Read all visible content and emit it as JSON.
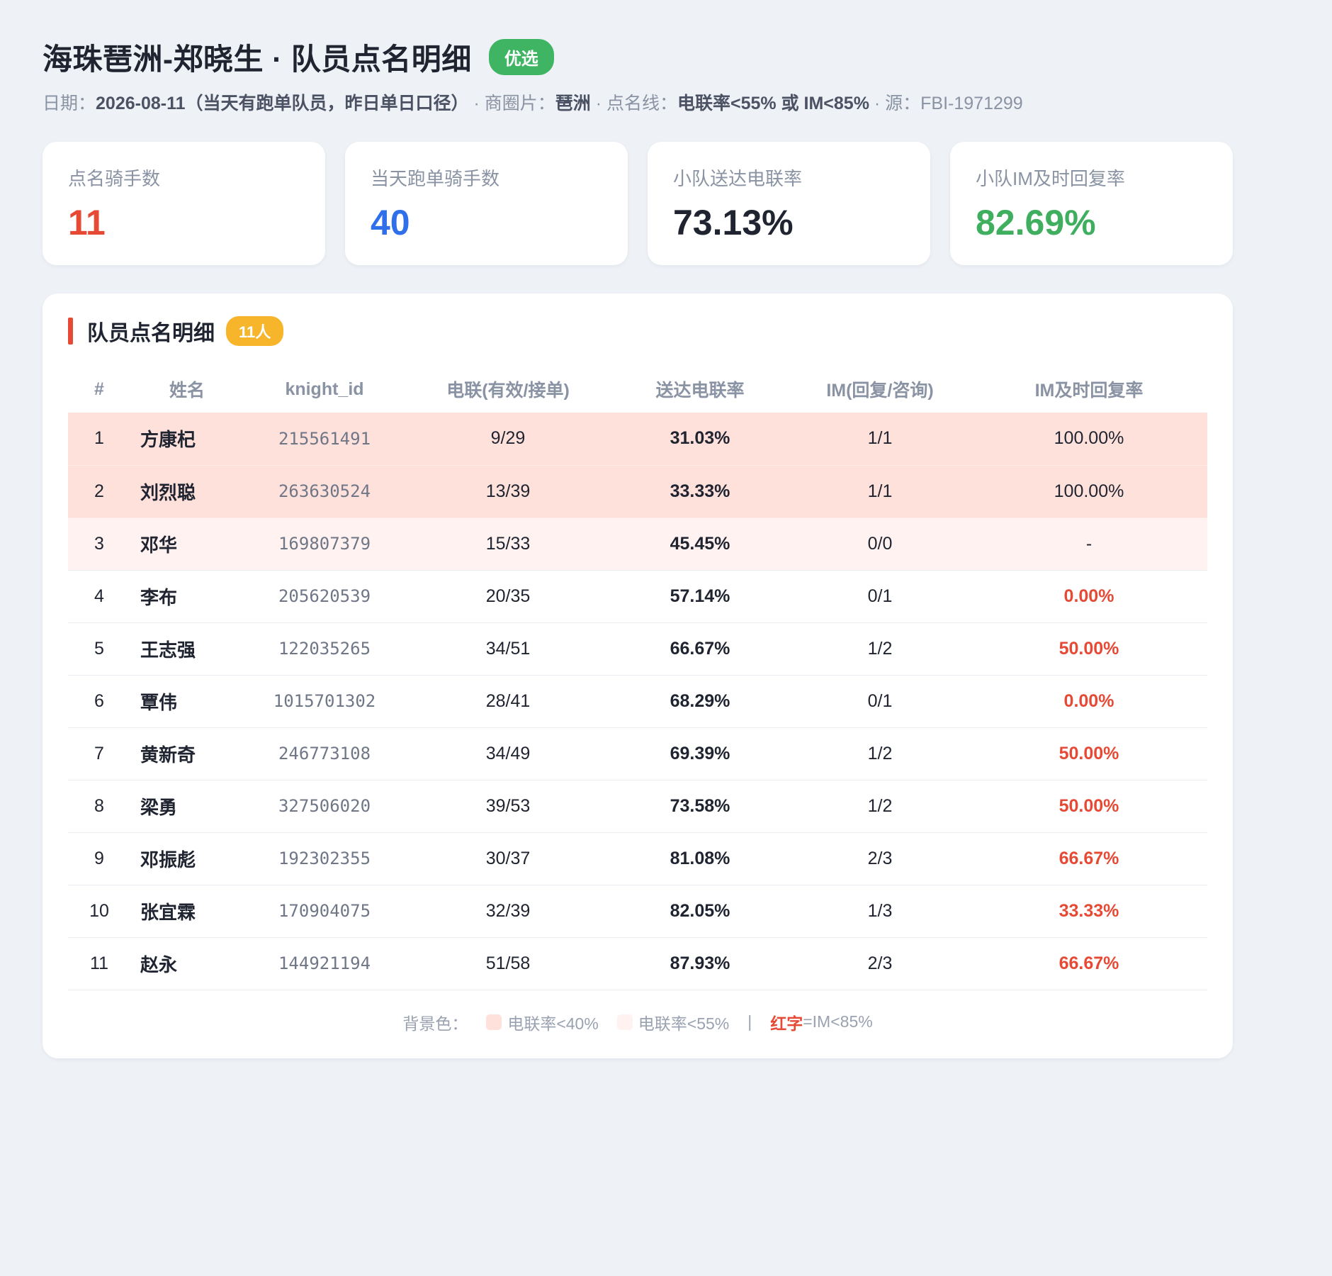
{
  "header": {
    "title": "海珠琶洲-郑晓生 · 队员点名明细",
    "badge": "优选",
    "date_label": "日期：",
    "date_value": "2026-08-11（当天有跑单队员，昨日单日口径）",
    "area_label": " · 商圈片：",
    "area_value": "琶洲",
    "line_label": " · 点名线：",
    "line_value": "电联率<55% 或 IM<85%",
    "source_text": " · 源：FBI-1971299"
  },
  "cards": [
    {
      "label": "点名骑手数",
      "value": "11",
      "color": "#e64a35"
    },
    {
      "label": "当天跑单骑手数",
      "value": "40",
      "color": "#2f6fea"
    },
    {
      "label": "小队送达电联率",
      "value": "73.13%",
      "color": "#1f2430"
    },
    {
      "label": "小队IM及时回复率",
      "value": "82.69%",
      "color": "#3fae5f"
    }
  ],
  "panel": {
    "title": "队员点名明细",
    "count": "11人"
  },
  "table": {
    "headers": [
      "#",
      "姓名",
      "knight_id",
      "电联(有效/接单)",
      "送达电联率",
      "IM(回复/咨询)",
      "IM及时回复率"
    ],
    "rows": [
      {
        "idx": "1",
        "name": "方康杞",
        "kid": "215561491",
        "call": "9/29",
        "rate": "31.03%",
        "im": "1/1",
        "im_rate": "100.00%",
        "bg": "strong",
        "im_bad": false
      },
      {
        "idx": "2",
        "name": "刘烈聪",
        "kid": "263630524",
        "call": "13/39",
        "rate": "33.33%",
        "im": "1/1",
        "im_rate": "100.00%",
        "bg": "strong",
        "im_bad": false
      },
      {
        "idx": "3",
        "name": "邓华",
        "kid": "169807379",
        "call": "15/33",
        "rate": "45.45%",
        "im": "0/0",
        "im_rate": "-",
        "bg": "light",
        "im_bad": false
      },
      {
        "idx": "4",
        "name": "李布",
        "kid": "205620539",
        "call": "20/35",
        "rate": "57.14%",
        "im": "0/1",
        "im_rate": "0.00%",
        "bg": "none",
        "im_bad": true
      },
      {
        "idx": "5",
        "name": "王志强",
        "kid": "122035265",
        "call": "34/51",
        "rate": "66.67%",
        "im": "1/2",
        "im_rate": "50.00%",
        "bg": "none",
        "im_bad": true
      },
      {
        "idx": "6",
        "name": "覃伟",
        "kid": "1015701302",
        "call": "28/41",
        "rate": "68.29%",
        "im": "0/1",
        "im_rate": "0.00%",
        "bg": "none",
        "im_bad": true
      },
      {
        "idx": "7",
        "name": "黄新奇",
        "kid": "246773108",
        "call": "34/49",
        "rate": "69.39%",
        "im": "1/2",
        "im_rate": "50.00%",
        "bg": "none",
        "im_bad": true
      },
      {
        "idx": "8",
        "name": "梁勇",
        "kid": "327506020",
        "call": "39/53",
        "rate": "73.58%",
        "im": "1/2",
        "im_rate": "50.00%",
        "bg": "none",
        "im_bad": true
      },
      {
        "idx": "9",
        "name": "邓振彪",
        "kid": "192302355",
        "call": "30/37",
        "rate": "81.08%",
        "im": "2/3",
        "im_rate": "66.67%",
        "bg": "none",
        "im_bad": true
      },
      {
        "idx": "10",
        "name": "张宜霖",
        "kid": "170904075",
        "call": "32/39",
        "rate": "82.05%",
        "im": "1/3",
        "im_rate": "33.33%",
        "bg": "none",
        "im_bad": true
      },
      {
        "idx": "11",
        "name": "赵永",
        "kid": "144921194",
        "call": "51/58",
        "rate": "87.93%",
        "im": "2/3",
        "im_rate": "66.67%",
        "bg": "none",
        "im_bad": true
      }
    ]
  },
  "legend": {
    "prefix": "背景色：",
    "strong_label": "电联率<40%",
    "light_label": "电联率<55%",
    "separator": "|",
    "red_word": "红字",
    "red_label": "=IM<85%",
    "strong_color": "#ffe1dc",
    "light_color": "#fff2f0"
  }
}
